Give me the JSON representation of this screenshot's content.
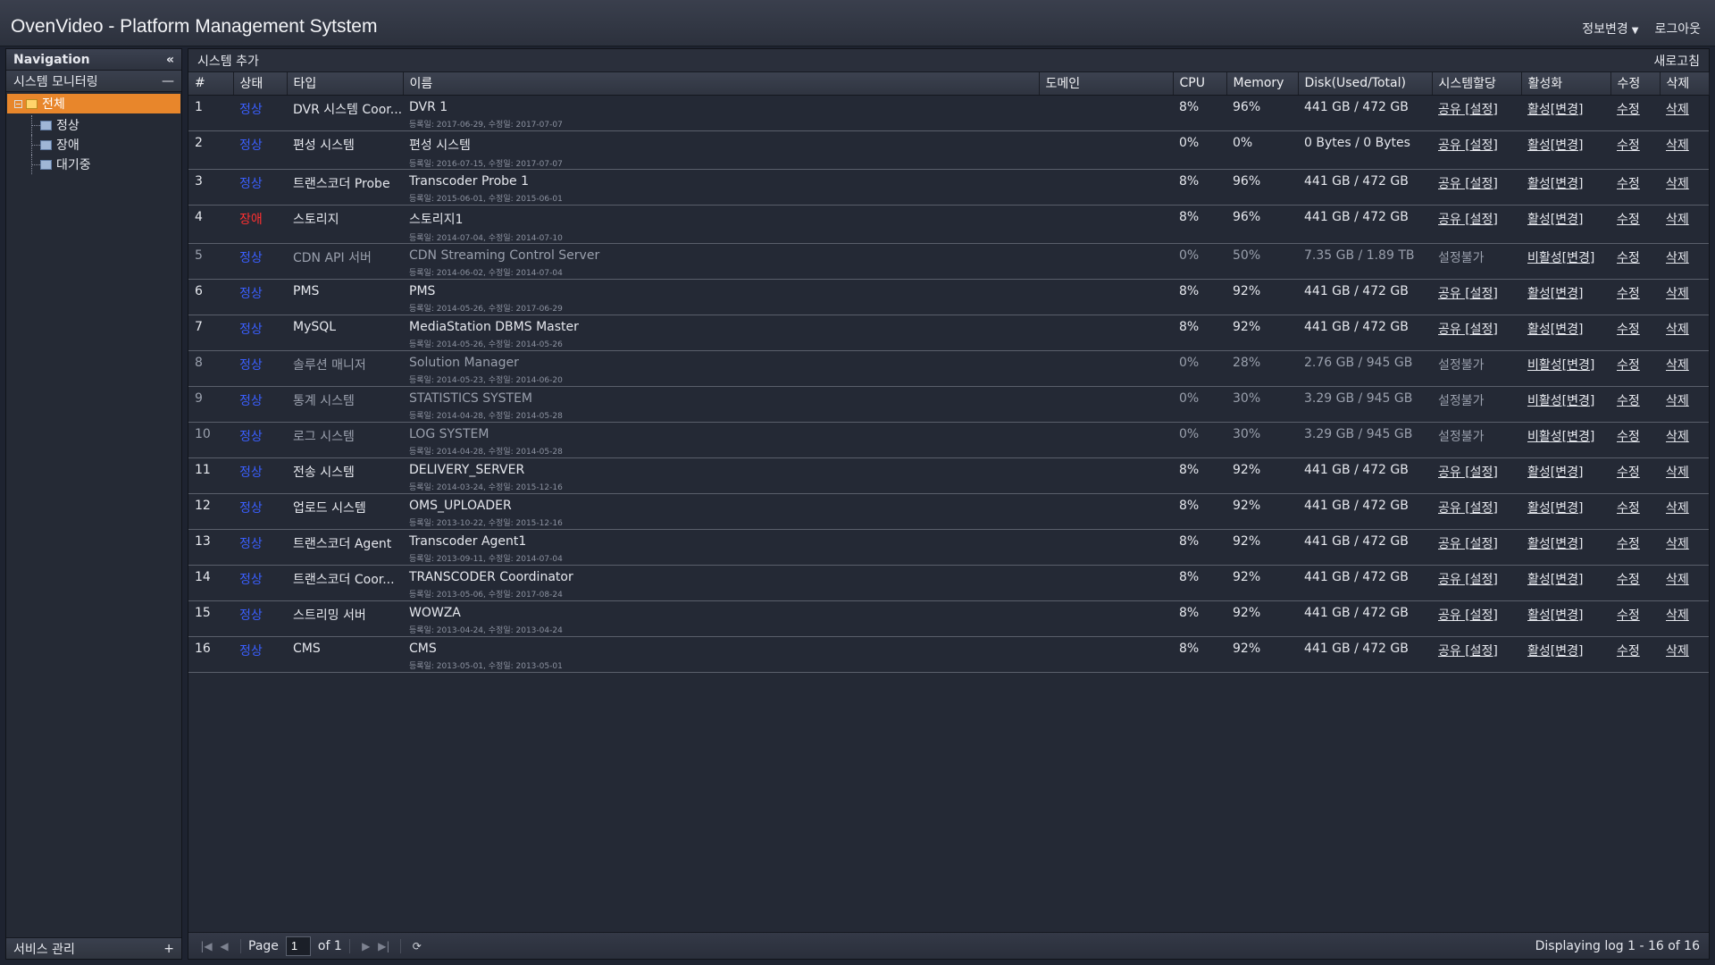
{
  "app": {
    "title": "OvenVideo - Platform Management Sytstem",
    "menu": {
      "info_change": "정보변경",
      "logout": "로그아웃"
    }
  },
  "nav": {
    "header": "Navigation",
    "section_monitoring": "시스템 모니터링",
    "tree": {
      "root": "전체",
      "children": [
        "정상",
        "장애",
        "대기중"
      ]
    },
    "section_service": "서비스 관리"
  },
  "toolbar": {
    "add_system": "시스템 추가",
    "refresh": "새로고침"
  },
  "table": {
    "columns": [
      "#",
      "상태",
      "타입",
      "이름",
      "도메인",
      "CPU",
      "Memory",
      "Disk(Used/Total)",
      "시스템할당",
      "활성화",
      "수정",
      "삭제"
    ],
    "rows": [
      {
        "no": "1",
        "status": "정상",
        "status_type": "ok",
        "type": "DVR 시스템 Coor...",
        "name": "DVR 1",
        "dates": "등록일: 2017-06-29, 수정일: 2017-07-07",
        "domain": "",
        "cpu": "8%",
        "memory": "96%",
        "disk": "441 GB / 472 GB",
        "assign": "공유 [설정]",
        "active": "활성[변경]",
        "edit": "수정",
        "delete": "삭제",
        "dim": false
      },
      {
        "no": "2",
        "status": "정상",
        "status_type": "ok",
        "type": "편성 시스템",
        "name": "편성 시스템",
        "dates": "등록일: 2016-07-15, 수정일: 2017-07-07",
        "domain": "",
        "cpu": "0%",
        "memory": "0%",
        "disk": "0 Bytes / 0 Bytes",
        "assign": "공유 [설정]",
        "active": "활성[변경]",
        "edit": "수정",
        "delete": "삭제",
        "dim": false
      },
      {
        "no": "3",
        "status": "정상",
        "status_type": "ok",
        "type": "트랜스코더 Probe",
        "name": "Transcoder Probe 1",
        "dates": "등록일: 2015-06-01, 수정일: 2015-06-01",
        "domain": "",
        "cpu": "8%",
        "memory": "96%",
        "disk": "441 GB / 472 GB",
        "assign": "공유 [설정]",
        "active": "활성[변경]",
        "edit": "수정",
        "delete": "삭제",
        "dim": false
      },
      {
        "no": "4",
        "status": "장애",
        "status_type": "fail",
        "type": "스토리지",
        "name": "스토리지1",
        "dates": "등록일: 2014-07-04, 수정일: 2014-07-10",
        "domain": "",
        "cpu": "8%",
        "memory": "96%",
        "disk": "441 GB / 472 GB",
        "assign": "공유 [설정]",
        "active": "활성[변경]",
        "edit": "수정",
        "delete": "삭제",
        "dim": false
      },
      {
        "no": "5",
        "status": "정상",
        "status_type": "ok",
        "type": "CDN API 서버",
        "name": "CDN Streaming Control Server",
        "dates": "등록일: 2014-06-02, 수정일: 2014-07-04",
        "domain": "",
        "cpu": "0%",
        "memory": "50%",
        "disk": "7.35 GB / 1.89 TB",
        "assign": "설정불가",
        "active": "비활성[변경]",
        "edit": "수정",
        "delete": "삭제",
        "dim": true
      },
      {
        "no": "6",
        "status": "정상",
        "status_type": "ok",
        "type": "PMS",
        "name": "PMS",
        "dates": "등록일: 2014-05-26, 수정일: 2017-06-29",
        "domain": "",
        "cpu": "8%",
        "memory": "92%",
        "disk": "441 GB / 472 GB",
        "assign": "공유 [설정]",
        "active": "활성[변경]",
        "edit": "수정",
        "delete": "삭제",
        "dim": false
      },
      {
        "no": "7",
        "status": "정상",
        "status_type": "ok",
        "type": "MySQL",
        "name": "MediaStation DBMS Master",
        "dates": "등록일: 2014-05-26, 수정일: 2014-05-26",
        "domain": "",
        "cpu": "8%",
        "memory": "92%",
        "disk": "441 GB / 472 GB",
        "assign": "공유 [설정]",
        "active": "활성[변경]",
        "edit": "수정",
        "delete": "삭제",
        "dim": false
      },
      {
        "no": "8",
        "status": "정상",
        "status_type": "ok",
        "type": "솔루션 매니저",
        "name": "Solution Manager",
        "dates": "등록일: 2014-05-23, 수정일: 2014-06-20",
        "domain": "",
        "cpu": "0%",
        "memory": "28%",
        "disk": "2.76 GB / 945 GB",
        "assign": "설정불가",
        "active": "비활성[변경]",
        "edit": "수정",
        "delete": "삭제",
        "dim": true
      },
      {
        "no": "9",
        "status": "정상",
        "status_type": "ok",
        "type": "통계 시스템",
        "name": "STATISTICS SYSTEM",
        "dates": "등록일: 2014-04-28, 수정일: 2014-05-28",
        "domain": "",
        "cpu": "0%",
        "memory": "30%",
        "disk": "3.29 GB / 945 GB",
        "assign": "설정불가",
        "active": "비활성[변경]",
        "edit": "수정",
        "delete": "삭제",
        "dim": true
      },
      {
        "no": "10",
        "status": "정상",
        "status_type": "ok",
        "type": "로그 시스템",
        "name": "LOG SYSTEM",
        "dates": "등록일: 2014-04-28, 수정일: 2014-05-28",
        "domain": "",
        "cpu": "0%",
        "memory": "30%",
        "disk": "3.29 GB / 945 GB",
        "assign": "설정불가",
        "active": "비활성[변경]",
        "edit": "수정",
        "delete": "삭제",
        "dim": true
      },
      {
        "no": "11",
        "status": "정상",
        "status_type": "ok",
        "type": "전송 시스템",
        "name": "DELIVERY_SERVER",
        "dates": "등록일: 2014-03-24, 수정일: 2015-12-16",
        "domain": "",
        "cpu": "8%",
        "memory": "92%",
        "disk": "441 GB / 472 GB",
        "assign": "공유 [설정]",
        "active": "활성[변경]",
        "edit": "수정",
        "delete": "삭제",
        "dim": false
      },
      {
        "no": "12",
        "status": "정상",
        "status_type": "ok",
        "type": "업로드 시스템",
        "name": "OMS_UPLOADER",
        "dates": "등록일: 2013-10-22, 수정일: 2015-12-16",
        "domain": "",
        "cpu": "8%",
        "memory": "92%",
        "disk": "441 GB / 472 GB",
        "assign": "공유 [설정]",
        "active": "활성[변경]",
        "edit": "수정",
        "delete": "삭제",
        "dim": false
      },
      {
        "no": "13",
        "status": "정상",
        "status_type": "ok",
        "type": "트랜스코더 Agent",
        "name": "Transcoder Agent1",
        "dates": "등록일: 2013-09-11, 수정일: 2014-07-04",
        "domain": "",
        "cpu": "8%",
        "memory": "92%",
        "disk": "441 GB / 472 GB",
        "assign": "공유 [설정]",
        "active": "활성[변경]",
        "edit": "수정",
        "delete": "삭제",
        "dim": false
      },
      {
        "no": "14",
        "status": "정상",
        "status_type": "ok",
        "type": "트랜스코더 Coor...",
        "name": "TRANSCODER Coordinator",
        "dates": "등록일: 2013-05-06, 수정일: 2017-08-24",
        "domain": "",
        "cpu": "8%",
        "memory": "92%",
        "disk": "441 GB / 472 GB",
        "assign": "공유 [설정]",
        "active": "활성[변경]",
        "edit": "수정",
        "delete": "삭제",
        "dim": false
      },
      {
        "no": "15",
        "status": "정상",
        "status_type": "ok",
        "type": "스트리밍 서버",
        "name": "WOWZA",
        "dates": "등록일: 2013-04-24, 수정일: 2013-04-24",
        "domain": "",
        "cpu": "8%",
        "memory": "92%",
        "disk": "441 GB / 472 GB",
        "assign": "공유 [설정]",
        "active": "활성[변경]",
        "edit": "수정",
        "delete": "삭제",
        "dim": false
      },
      {
        "no": "16",
        "status": "정상",
        "status_type": "ok",
        "type": "CMS",
        "name": "CMS",
        "dates": "등록일: 2013-05-01, 수정일: 2013-05-01",
        "domain": "",
        "cpu": "8%",
        "memory": "92%",
        "disk": "441 GB / 472 GB",
        "assign": "공유 [설정]",
        "active": "활성[변경]",
        "edit": "수정",
        "delete": "삭제",
        "dim": false
      }
    ]
  },
  "pager": {
    "page_label": "Page",
    "current_page": "1",
    "of_label": "of 1",
    "info": "Displaying log 1 - 16 of 16"
  },
  "colors": {
    "status_ok": "#3a5fff",
    "status_fail": "#ff3030",
    "accent": "#e8862b"
  }
}
